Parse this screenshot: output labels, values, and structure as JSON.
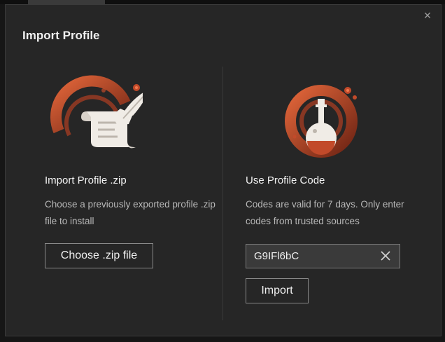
{
  "dialog": {
    "title": "Import Profile",
    "close_icon": "close-icon"
  },
  "zip_section": {
    "icon": "scroll-quill-icon",
    "heading": "Import Profile .zip",
    "description": "Choose a previously exported profile .zip file to install",
    "button_label": "Choose .zip file"
  },
  "code_section": {
    "icon": "potion-flask-icon",
    "heading": "Use Profile Code",
    "description": "Codes are valid for 7 days. Only enter codes from trusted sources",
    "code_value": "G9IFl6bC",
    "clear_icon": "clear-icon",
    "button_label": "Import"
  },
  "colors": {
    "accent": "#d2532f",
    "accent_dark": "#8a2f1a",
    "dialog_bg": "#262626",
    "border": "#3a3a3a"
  }
}
